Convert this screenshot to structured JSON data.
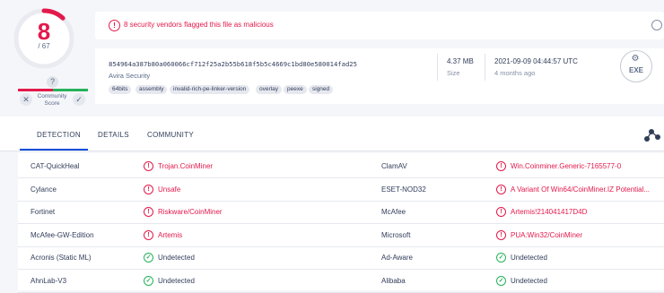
{
  "score": {
    "detected": "8",
    "total": "/ 67",
    "detection_fraction": 0.119
  },
  "community": {
    "help_icon": "?",
    "label_line1": "Community",
    "label_line2": "Score"
  },
  "alert": {
    "text": "8 security vendors flagged this file as malicious"
  },
  "file": {
    "hash": "854964a387b80a060066cf712f25a2b55b618f5b5c4669c1bd80e580014fad25",
    "vendor": "Avira Security",
    "tags": [
      "64bits",
      "assembly",
      "invalid-rich-pe-linker-version",
      "overlay",
      "peexe",
      "signed"
    ],
    "size_value": "4.37 MB",
    "size_label": "Size",
    "date_value": "2021-09-09 04:44:57 UTC",
    "date_label": "4 months ago",
    "type_label": "EXE",
    "type_icon": "file-type-icon"
  },
  "tabs": [
    {
      "label": "DETECTION",
      "active": true
    },
    {
      "label": "DETAILS",
      "active": false
    },
    {
      "label": "COMMUNITY",
      "active": false
    }
  ],
  "detections": [
    {
      "left": {
        "engine": "CAT-QuickHeal",
        "result": "Trojan.CoinMiner",
        "status": "malicious"
      },
      "right": {
        "engine": "ClamAV",
        "result": "Win.Coinminer.Generic-7165577-0",
        "status": "malicious"
      }
    },
    {
      "left": {
        "engine": "Cylance",
        "result": "Unsafe",
        "status": "malicious"
      },
      "right": {
        "engine": "ESET-NOD32",
        "result": "A Variant Of Win64/CoinMiner.IZ Potential...",
        "status": "malicious"
      }
    },
    {
      "left": {
        "engine": "Fortinet",
        "result": "Riskware/CoinMiner",
        "status": "malicious"
      },
      "right": {
        "engine": "McAfee",
        "result": "Artemis!214041417D4D",
        "status": "malicious"
      }
    },
    {
      "left": {
        "engine": "McAfee-GW-Edition",
        "result": "Artemis",
        "status": "malicious"
      },
      "right": {
        "engine": "Microsoft",
        "result": "PUA:Win32/CoinMiner",
        "status": "malicious"
      }
    },
    {
      "left": {
        "engine": "Acronis (Static ML)",
        "result": "Undetected",
        "status": "undetected"
      },
      "right": {
        "engine": "Ad-Aware",
        "result": "Undetected",
        "status": "undetected"
      }
    },
    {
      "left": {
        "engine": "AhnLab-V3",
        "result": "Undetected",
        "status": "undetected"
      },
      "right": {
        "engine": "Alibaba",
        "result": "Undetected",
        "status": "undetected"
      }
    }
  ],
  "colors": {
    "malicious": "#e3194b",
    "undetected": "#26b25b",
    "accent": "#0b4dda"
  }
}
